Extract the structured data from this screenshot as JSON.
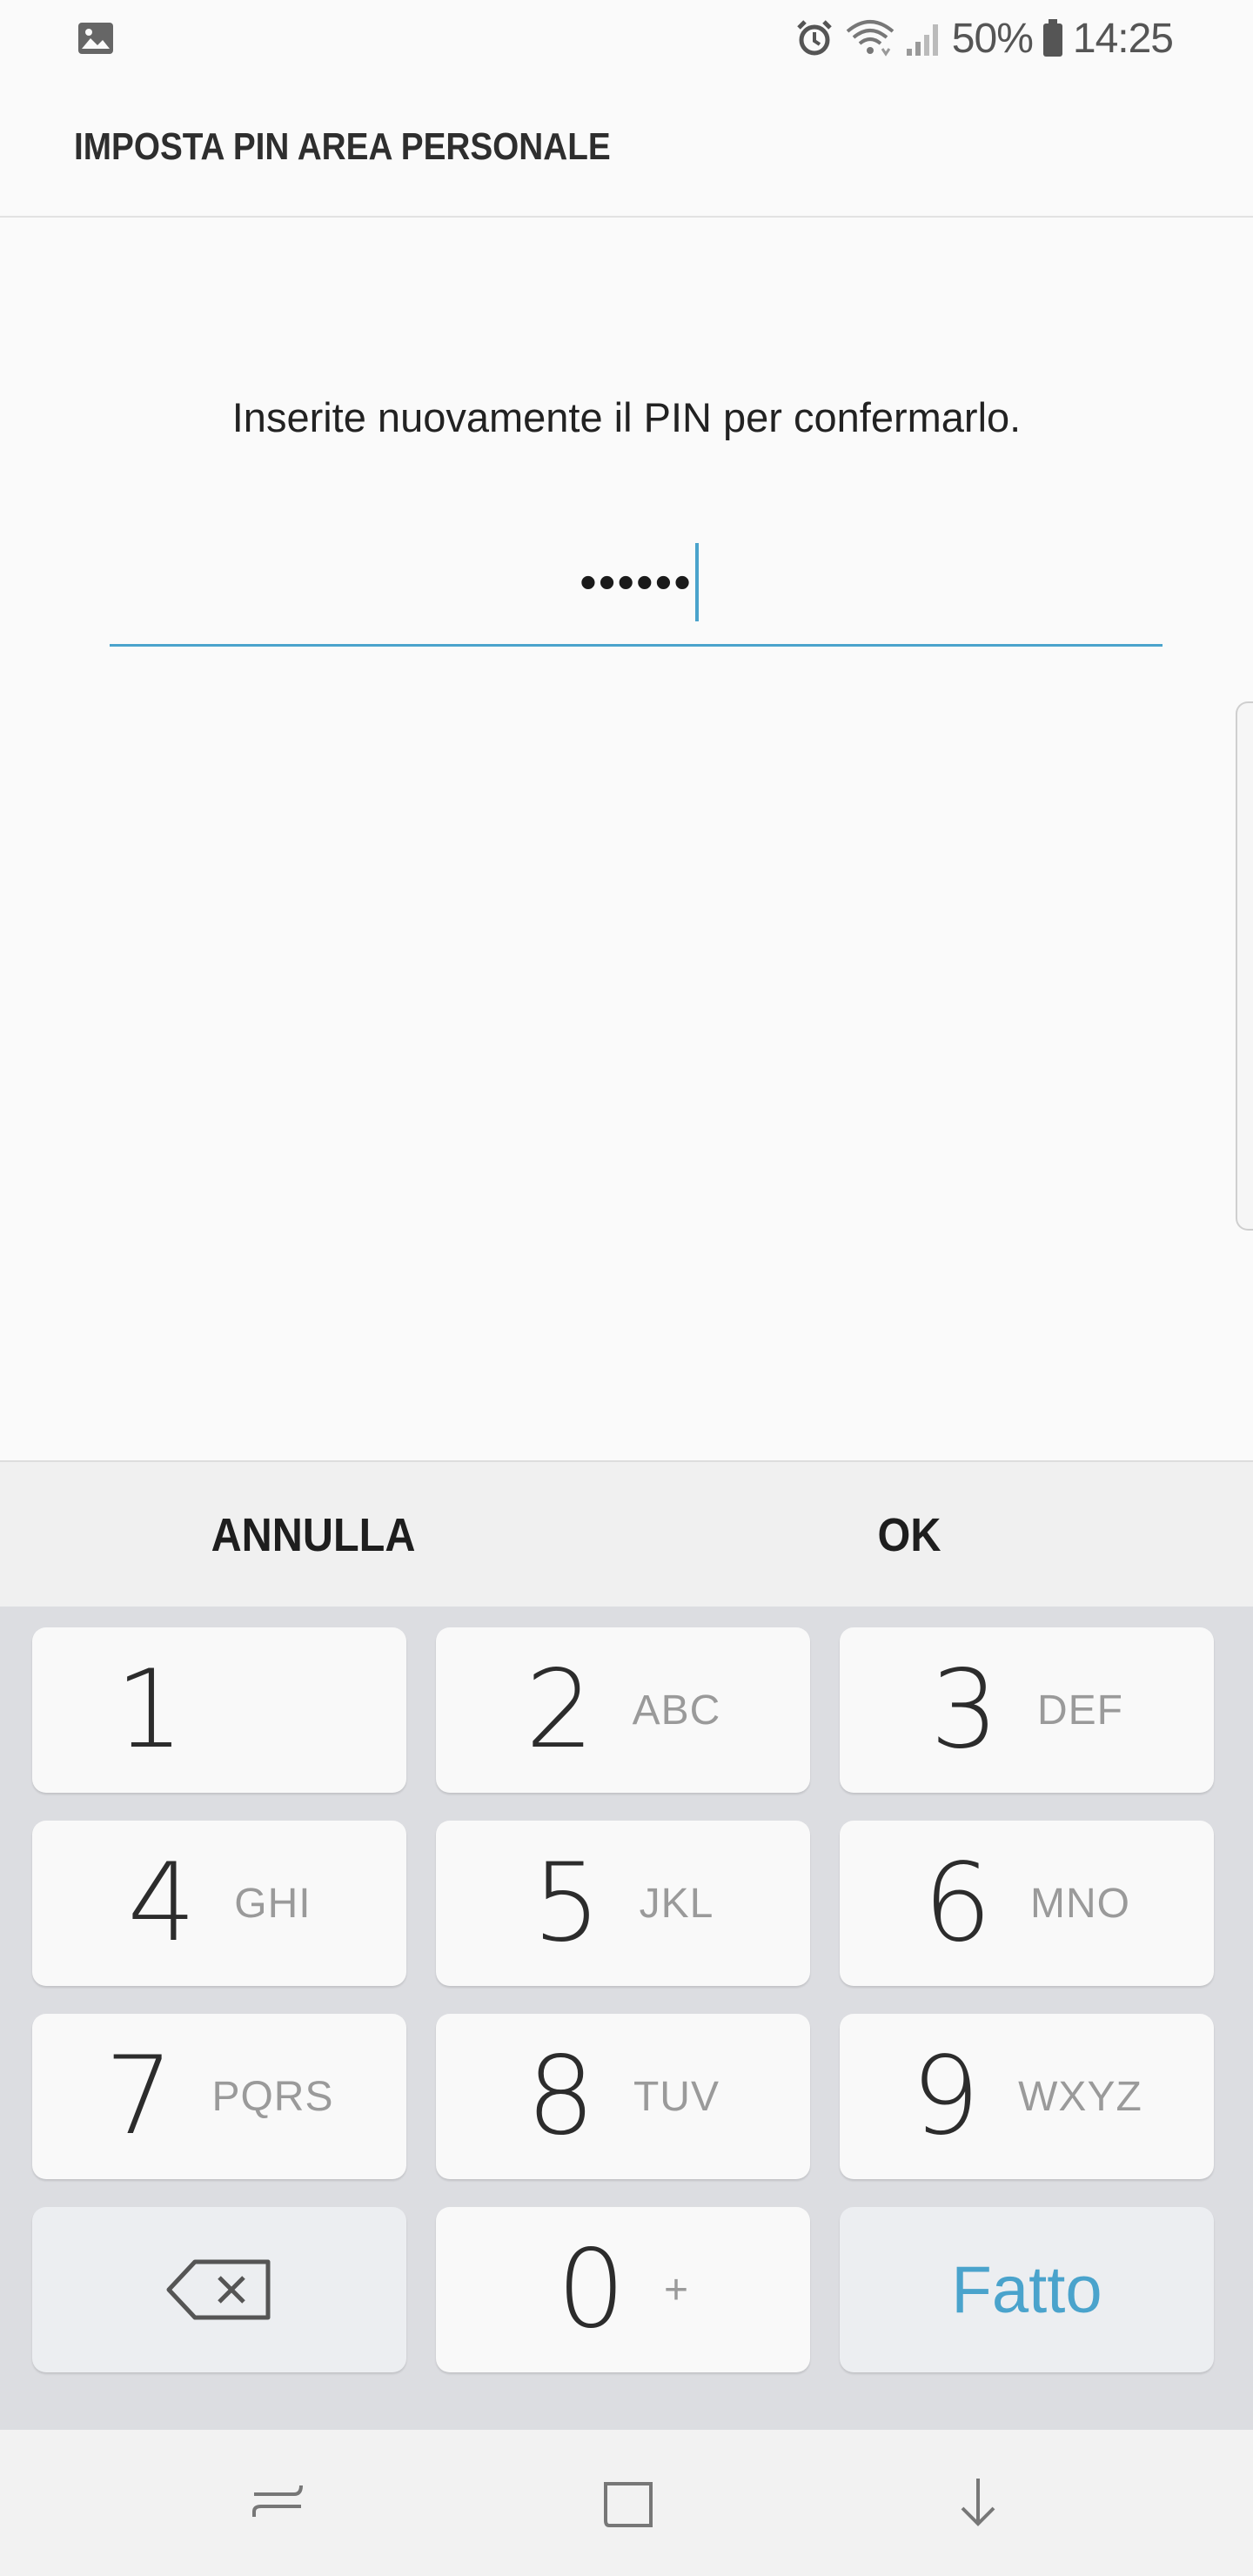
{
  "status_bar": {
    "left_icon": "image-notification-icon",
    "icons": [
      "alarm-icon",
      "wifi-icon",
      "signal-icon",
      "battery-icon"
    ],
    "battery_percent": "50%",
    "time": "14:25"
  },
  "header": {
    "title": "IMPOSTA PIN AREA PERSONALE"
  },
  "content": {
    "instruction": "Inserite nuovamente il PIN per confermarlo.",
    "pin_masked": "••••••"
  },
  "dialog_buttons": {
    "cancel_label": "ANNULLA",
    "ok_label": "OK"
  },
  "keypad": {
    "keys": [
      {
        "digit": "1",
        "letters": ""
      },
      {
        "digit": "2",
        "letters": "ABC"
      },
      {
        "digit": "3",
        "letters": "DEF"
      },
      {
        "digit": "4",
        "letters": "GHI"
      },
      {
        "digit": "5",
        "letters": "JKL"
      },
      {
        "digit": "6",
        "letters": "MNO"
      },
      {
        "digit": "7",
        "letters": "PQRS"
      },
      {
        "digit": "8",
        "letters": "TUV"
      },
      {
        "digit": "9",
        "letters": "WXYZ"
      },
      {
        "digit": "0",
        "letters": "+"
      }
    ],
    "backspace_icon": "backspace-icon",
    "done_label": "Fatto"
  },
  "nav_bar": {
    "icons": [
      "recent-apps-icon",
      "home-icon",
      "hide-keyboard-icon"
    ]
  },
  "colors": {
    "accent": "#4aa3cc",
    "background": "#fafafa",
    "keypad_background": "#dcdde1"
  }
}
